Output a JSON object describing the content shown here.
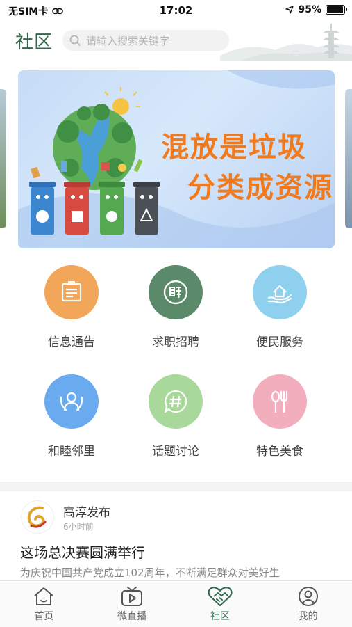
{
  "status_bar": {
    "carrier": "无SIM卡",
    "time": "17:02",
    "battery": "95%",
    "battery_level": 0.95
  },
  "header": {
    "title": "社区",
    "search_placeholder": "请输入搜索关键字"
  },
  "banner": {
    "line1": "混放是垃圾",
    "line2": "分类成资源"
  },
  "services": [
    {
      "label": "信息通告",
      "icon": "notice-board-icon",
      "color": "#f2a65a"
    },
    {
      "label": "求职招聘",
      "icon": "recruit-icon",
      "color": "#5b8a6a"
    },
    {
      "label": "便民服务",
      "icon": "helping-hand-house-icon",
      "color": "#8fd0ee"
    },
    {
      "label": "和睦邻里",
      "icon": "neighbors-icon",
      "color": "#6aabef"
    },
    {
      "label": "话题讨论",
      "icon": "hashtag-chat-icon",
      "color": "#a9d99a"
    },
    {
      "label": "特色美食",
      "icon": "spoon-fork-icon",
      "color": "#f3aebd"
    }
  ],
  "news": {
    "source": "高淳发布",
    "time": "6小时前",
    "title": "这场总决赛圆满举行",
    "summary": "为庆祝中国共产党成立102周年，不断满足群众对美好生"
  },
  "tab_bar": [
    {
      "label": "首页",
      "icon": "home-icon",
      "active": false
    },
    {
      "label": "微直播",
      "icon": "live-play-icon",
      "active": false
    },
    {
      "label": "社区",
      "icon": "community-heart-icon",
      "active": true
    },
    {
      "label": "我的",
      "icon": "profile-icon",
      "active": false
    }
  ],
  "colors": {
    "brand_green": "#2f6b4c",
    "banner_text": "#f07a1c"
  }
}
